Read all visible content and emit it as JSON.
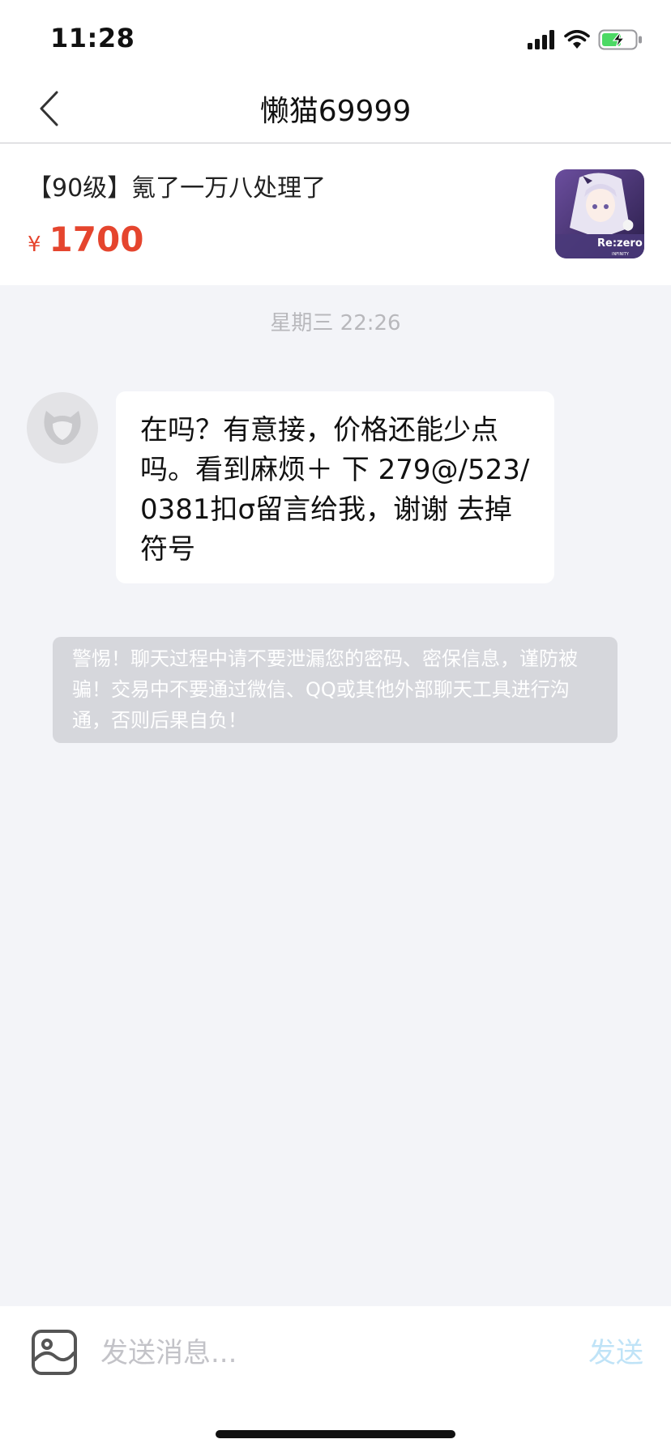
{
  "status_bar": {
    "time": "11:28",
    "battery_level": 0.6,
    "icons": [
      "signal-icon",
      "wifi-icon",
      "battery-charging-icon"
    ]
  },
  "nav": {
    "title": "懒猫69999",
    "back_icon": "chevron-left-icon"
  },
  "product": {
    "title": "【90级】氪了一万八处理了",
    "currency": "¥",
    "price": "1700",
    "thumbnail": {
      "text_line1": "Re:zero",
      "text_line2": "INFINITY"
    }
  },
  "chat": {
    "timestamp": "星期三 22:26",
    "messages": [
      {
        "sender": "other",
        "text": "在吗？有意接，价格还能少点吗。看到麻烦＋ 下 279@/523/0381扣σ留言给我，谢谢 去掉符号"
      }
    ],
    "warning": "警惕！聊天过程中请不要泄漏您的密码、密保信息，谨防被骗！交易中不要通过微信、QQ或其他外部聊天工具进行沟通，否则后果自负！"
  },
  "input_bar": {
    "placeholder": "发送消息...",
    "send_label": "发送",
    "image_icon": "image-icon"
  },
  "colors": {
    "price": "#e5452e",
    "send_disabled": "#bfe3f7",
    "background": "#f3f4f8"
  }
}
